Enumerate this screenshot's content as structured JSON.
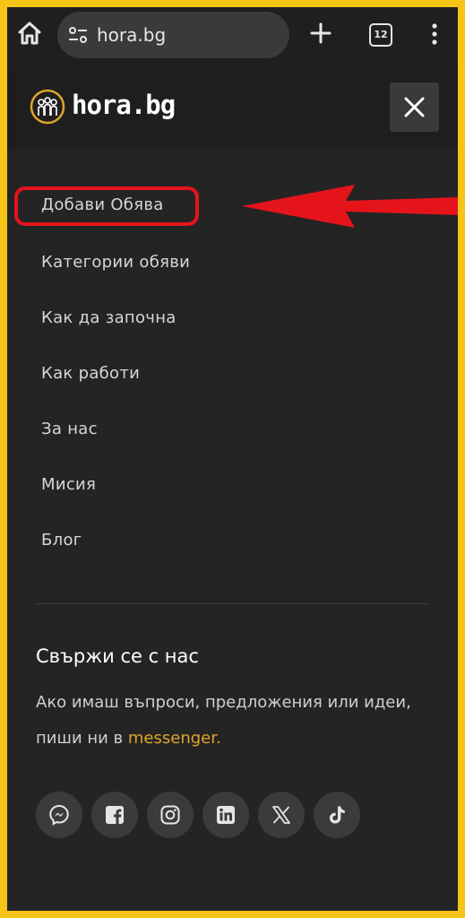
{
  "browser": {
    "url": "hora.bg",
    "tab_count": "12"
  },
  "header": {
    "logo_text": "hora.bg"
  },
  "nav": {
    "items": [
      {
        "label": "Добави Обява",
        "id": "add-listing"
      },
      {
        "label": "Категории обяви",
        "id": "categories"
      },
      {
        "label": "Как да започна",
        "id": "how-to-start"
      },
      {
        "label": "Как работи",
        "id": "how-it-works"
      },
      {
        "label": "За нас",
        "id": "about"
      },
      {
        "label": "Мисия",
        "id": "mission"
      },
      {
        "label": "Блог",
        "id": "blog"
      }
    ]
  },
  "contact": {
    "title": "Свържи се с нас",
    "text_before": "Ако имаш въпроси, предложения или идеи, пиши ни в ",
    "link_text": "messenger."
  },
  "socials": [
    {
      "icon": "messenger-icon"
    },
    {
      "icon": "facebook-icon"
    },
    {
      "icon": "instagram-icon"
    },
    {
      "icon": "linkedin-icon"
    },
    {
      "icon": "x-icon"
    },
    {
      "icon": "tiktok-icon"
    }
  ],
  "colors": {
    "annotation": "#e5141b",
    "link": "#e0a52a",
    "frame": "#f6c417",
    "background": "#242424"
  }
}
